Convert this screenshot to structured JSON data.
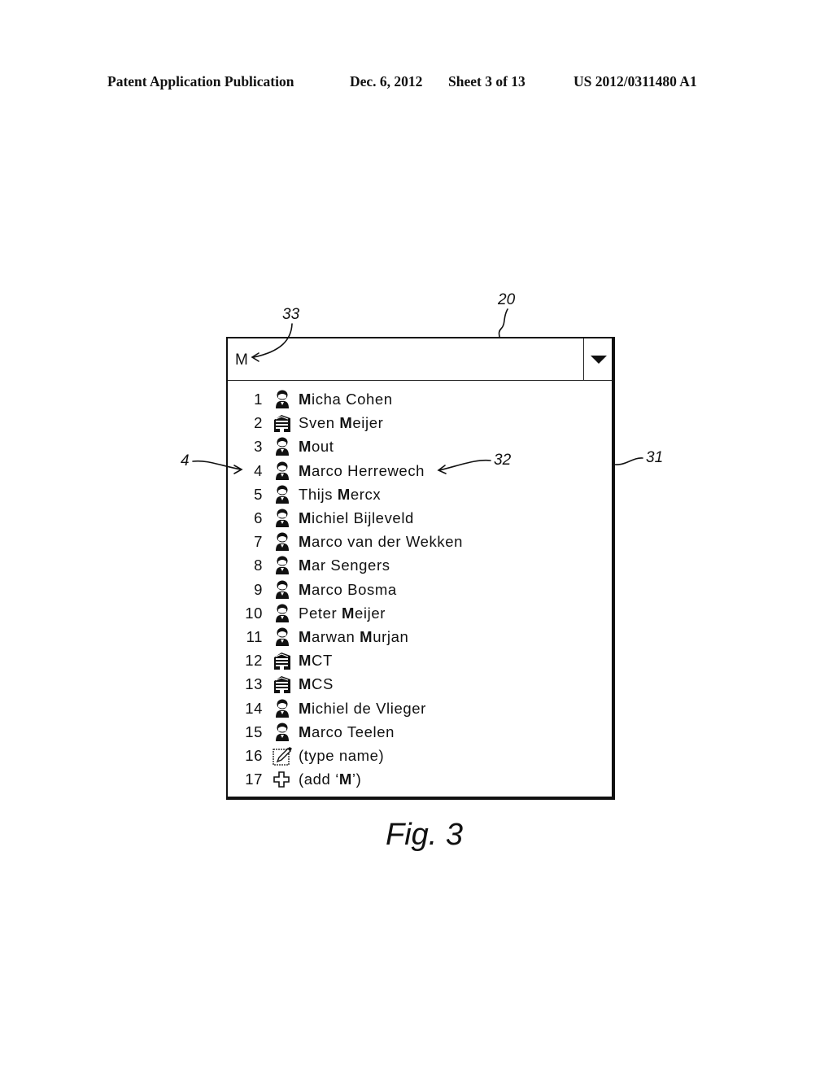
{
  "header": {
    "publication": "Patent Application Publication",
    "date": "Dec. 6, 2012",
    "sheet": "Sheet 3 of 13",
    "number": "US 2012/0311480 A1"
  },
  "widget": {
    "input_value": "M",
    "dropdown_icon": "triangle-down-icon",
    "items": [
      {
        "num": "1",
        "icon": "person-icon",
        "label": "Micha Cohen",
        "highlight": "M"
      },
      {
        "num": "2",
        "icon": "building-icon",
        "label": "Sven Meijer",
        "highlight": "M"
      },
      {
        "num": "3",
        "icon": "person-icon",
        "label": "Mout",
        "highlight": "M"
      },
      {
        "num": "4",
        "icon": "person-icon",
        "label": "Marco Herrewech",
        "highlight": "M"
      },
      {
        "num": "5",
        "icon": "person-icon",
        "label": "Thijs Mercx",
        "highlight": "M"
      },
      {
        "num": "6",
        "icon": "person-icon",
        "label": "Michiel Bijleveld",
        "highlight": "M"
      },
      {
        "num": "7",
        "icon": "person-icon",
        "label": "Marco van der Wekken",
        "highlight": "M"
      },
      {
        "num": "8",
        "icon": "person-icon",
        "label": "Mar Sengers",
        "highlight": "M"
      },
      {
        "num": "9",
        "icon": "person-icon",
        "label": "Marco Bosma",
        "highlight": "M"
      },
      {
        "num": "10",
        "icon": "person-icon",
        "label": "Peter Meijer",
        "highlight": "M"
      },
      {
        "num": "11",
        "icon": "person-icon",
        "label": "Marwan Murjan",
        "highlight": "M"
      },
      {
        "num": "12",
        "icon": "building-icon",
        "label": "MCT",
        "highlight": "M"
      },
      {
        "num": "13",
        "icon": "building-icon",
        "label": "MCS",
        "highlight": "M"
      },
      {
        "num": "14",
        "icon": "person-icon",
        "label": "Michiel de Vlieger",
        "highlight": "M"
      },
      {
        "num": "15",
        "icon": "person-icon",
        "label": "Marco Teelen",
        "highlight": "M"
      },
      {
        "num": "16",
        "icon": "edit-icon",
        "label": "(type name)",
        "highlight": ""
      },
      {
        "num": "17",
        "icon": "plus-icon",
        "label": "(add ‘M’)",
        "highlight": "M"
      }
    ]
  },
  "callouts": {
    "input_field": "33",
    "widget": "20",
    "list_item": "32",
    "list_box": "31",
    "item_number": "4"
  },
  "figure_label": "Fig. 3"
}
